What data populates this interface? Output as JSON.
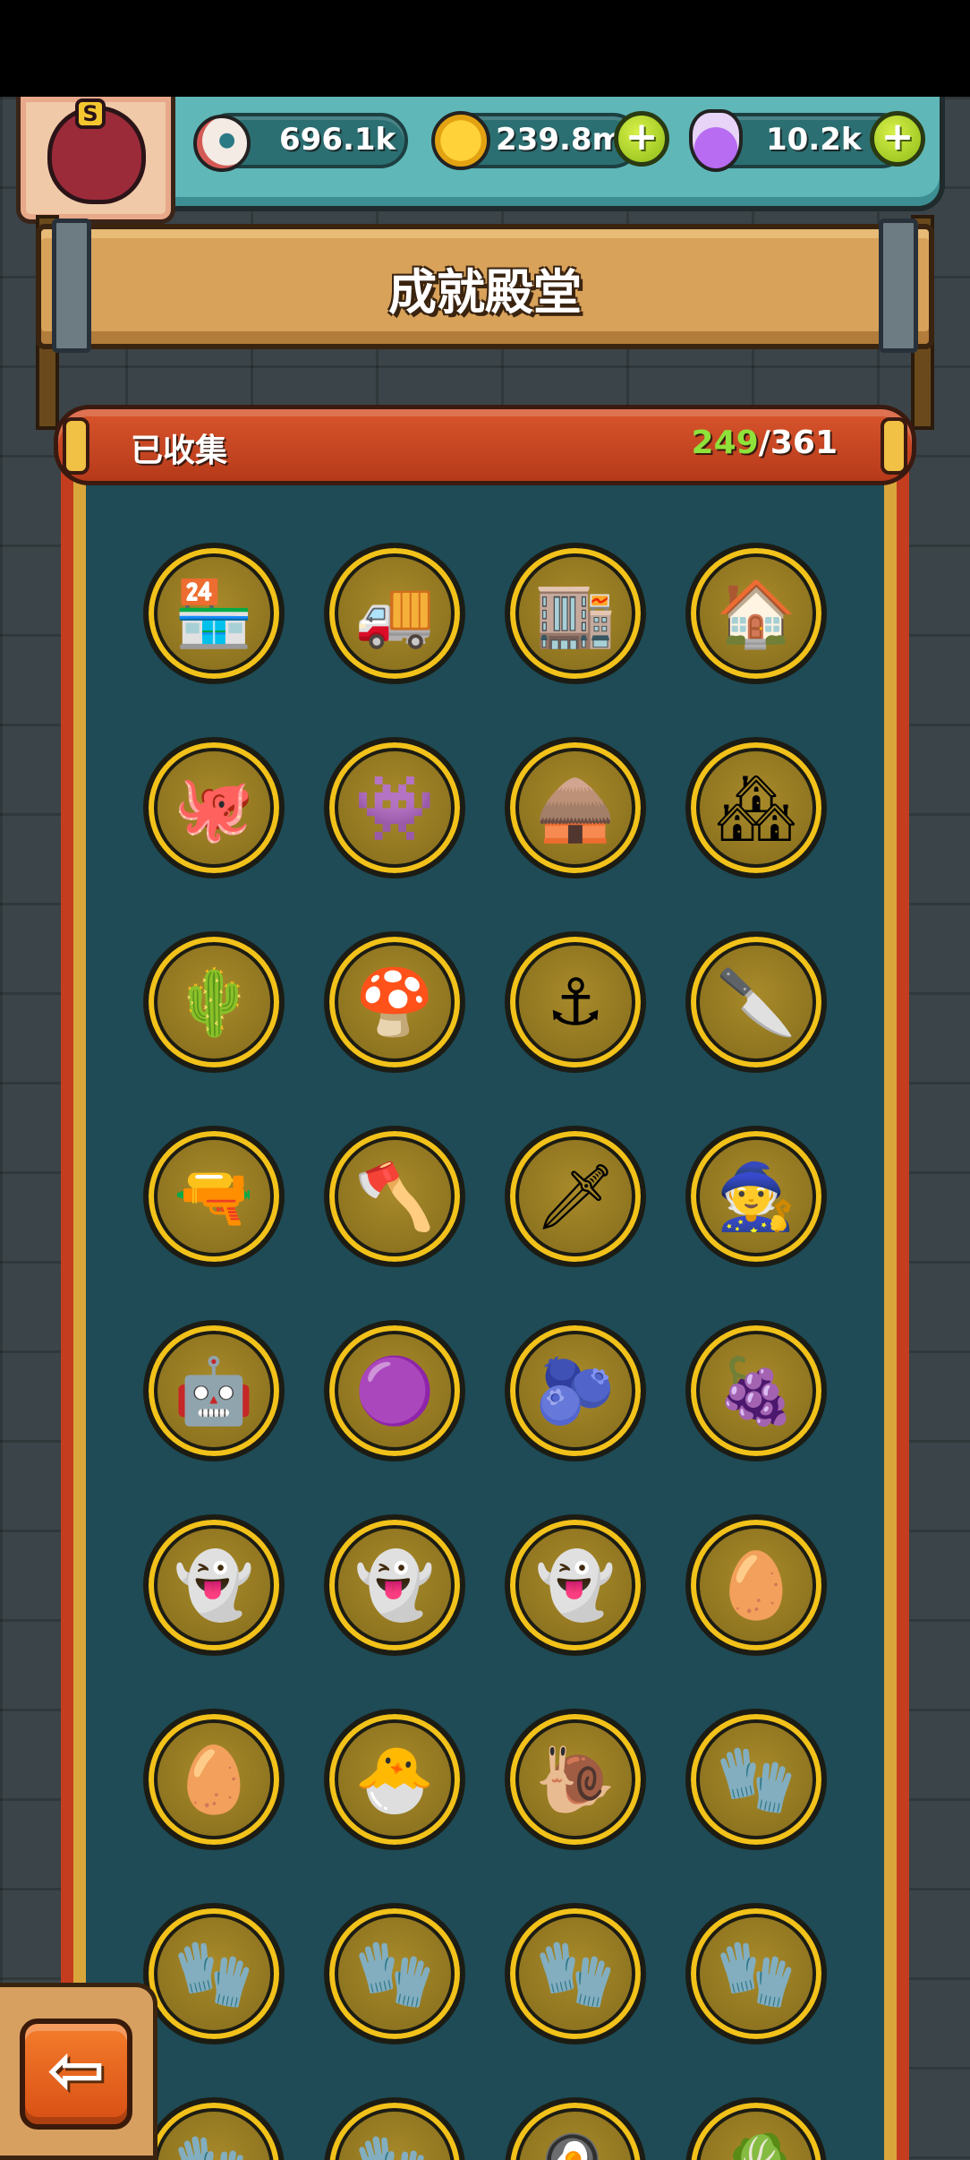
{
  "resources": [
    {
      "name": "eyeball",
      "value": "696.1k",
      "icon": "eyeball-icon"
    },
    {
      "name": "coin",
      "value": "239.8m",
      "icon": "gold-coin-icon"
    },
    {
      "name": "potion",
      "value": "10.2k",
      "icon": "purple-potion-icon"
    }
  ],
  "avatar": {
    "badge_letter": "S",
    "icon": "monster-avatar-icon"
  },
  "title": "成就殿堂",
  "collection": {
    "label": "已收集",
    "collected": "249",
    "separator": "/",
    "total": "361"
  },
  "achievements": [
    {
      "icon": "market-stall-icon",
      "glyph": "🏪"
    },
    {
      "icon": "food-truck-icon",
      "glyph": "🚚"
    },
    {
      "icon": "shop-counter-icon",
      "glyph": "🏬"
    },
    {
      "icon": "monster-house-icon",
      "glyph": "🏠"
    },
    {
      "icon": "tentacle-icon",
      "glyph": "🐙"
    },
    {
      "icon": "octopus-monster-icon",
      "glyph": "👾"
    },
    {
      "icon": "wooden-hut-icon",
      "glyph": "🛖"
    },
    {
      "icon": "village-houses-icon",
      "glyph": "🏘"
    },
    {
      "icon": "cactus-skull-icon",
      "glyph": "🌵"
    },
    {
      "icon": "orange-mushroom-icon",
      "glyph": "🍄"
    },
    {
      "icon": "anchor-icon",
      "glyph": "⚓"
    },
    {
      "icon": "shadow-knife-icon",
      "glyph": "🔪"
    },
    {
      "icon": "shadow-pistol-icon",
      "glyph": "🔫"
    },
    {
      "icon": "shadow-cleaver-icon",
      "glyph": "🪓"
    },
    {
      "icon": "shadow-sword-icon",
      "glyph": "🗡"
    },
    {
      "icon": "shadow-wizard-icon",
      "glyph": "🧙"
    },
    {
      "icon": "robot-soldier-icon",
      "glyph": "🤖"
    },
    {
      "icon": "purple-slime-icon",
      "glyph": "🟣"
    },
    {
      "icon": "purple-slime-double-icon",
      "glyph": "🫐"
    },
    {
      "icon": "purple-slime-triple-icon",
      "glyph": "🍇"
    },
    {
      "icon": "ghost-icon",
      "glyph": "👻"
    },
    {
      "icon": "ghost-pair-icon",
      "glyph": "👻"
    },
    {
      "icon": "ghost-group-icon",
      "glyph": "👻"
    },
    {
      "icon": "striped-egg-icon",
      "glyph": "🥚"
    },
    {
      "icon": "cracked-egg-icon",
      "glyph": "🥚"
    },
    {
      "icon": "hatching-monster-icon",
      "glyph": "🐣"
    },
    {
      "icon": "hatching-snail-icon",
      "glyph": "🐌"
    },
    {
      "icon": "white-glove-icon",
      "glyph": "🧤"
    },
    {
      "icon": "green-glove-icon",
      "glyph": "🧤"
    },
    {
      "icon": "blue-glove-icon",
      "glyph": "🧤"
    },
    {
      "icon": "purple-glove-icon",
      "glyph": "🧤"
    },
    {
      "icon": "yellow-glove-icon",
      "glyph": "🧤"
    },
    {
      "icon": "red-glove-icon",
      "glyph": "🧤"
    },
    {
      "icon": "rainbow-glove-icon",
      "glyph": "🧤"
    },
    {
      "icon": "eyeball-dish-icon",
      "glyph": "🍳"
    },
    {
      "icon": "salad-icon",
      "glyph": "🥬"
    }
  ],
  "back_button": {
    "label": "⇦",
    "icon": "back-arrow-icon"
  },
  "colors": {
    "accent_green": "#8fe23a",
    "medal_gold": "#f2c21a",
    "scroll_teal": "#1e4b55"
  }
}
